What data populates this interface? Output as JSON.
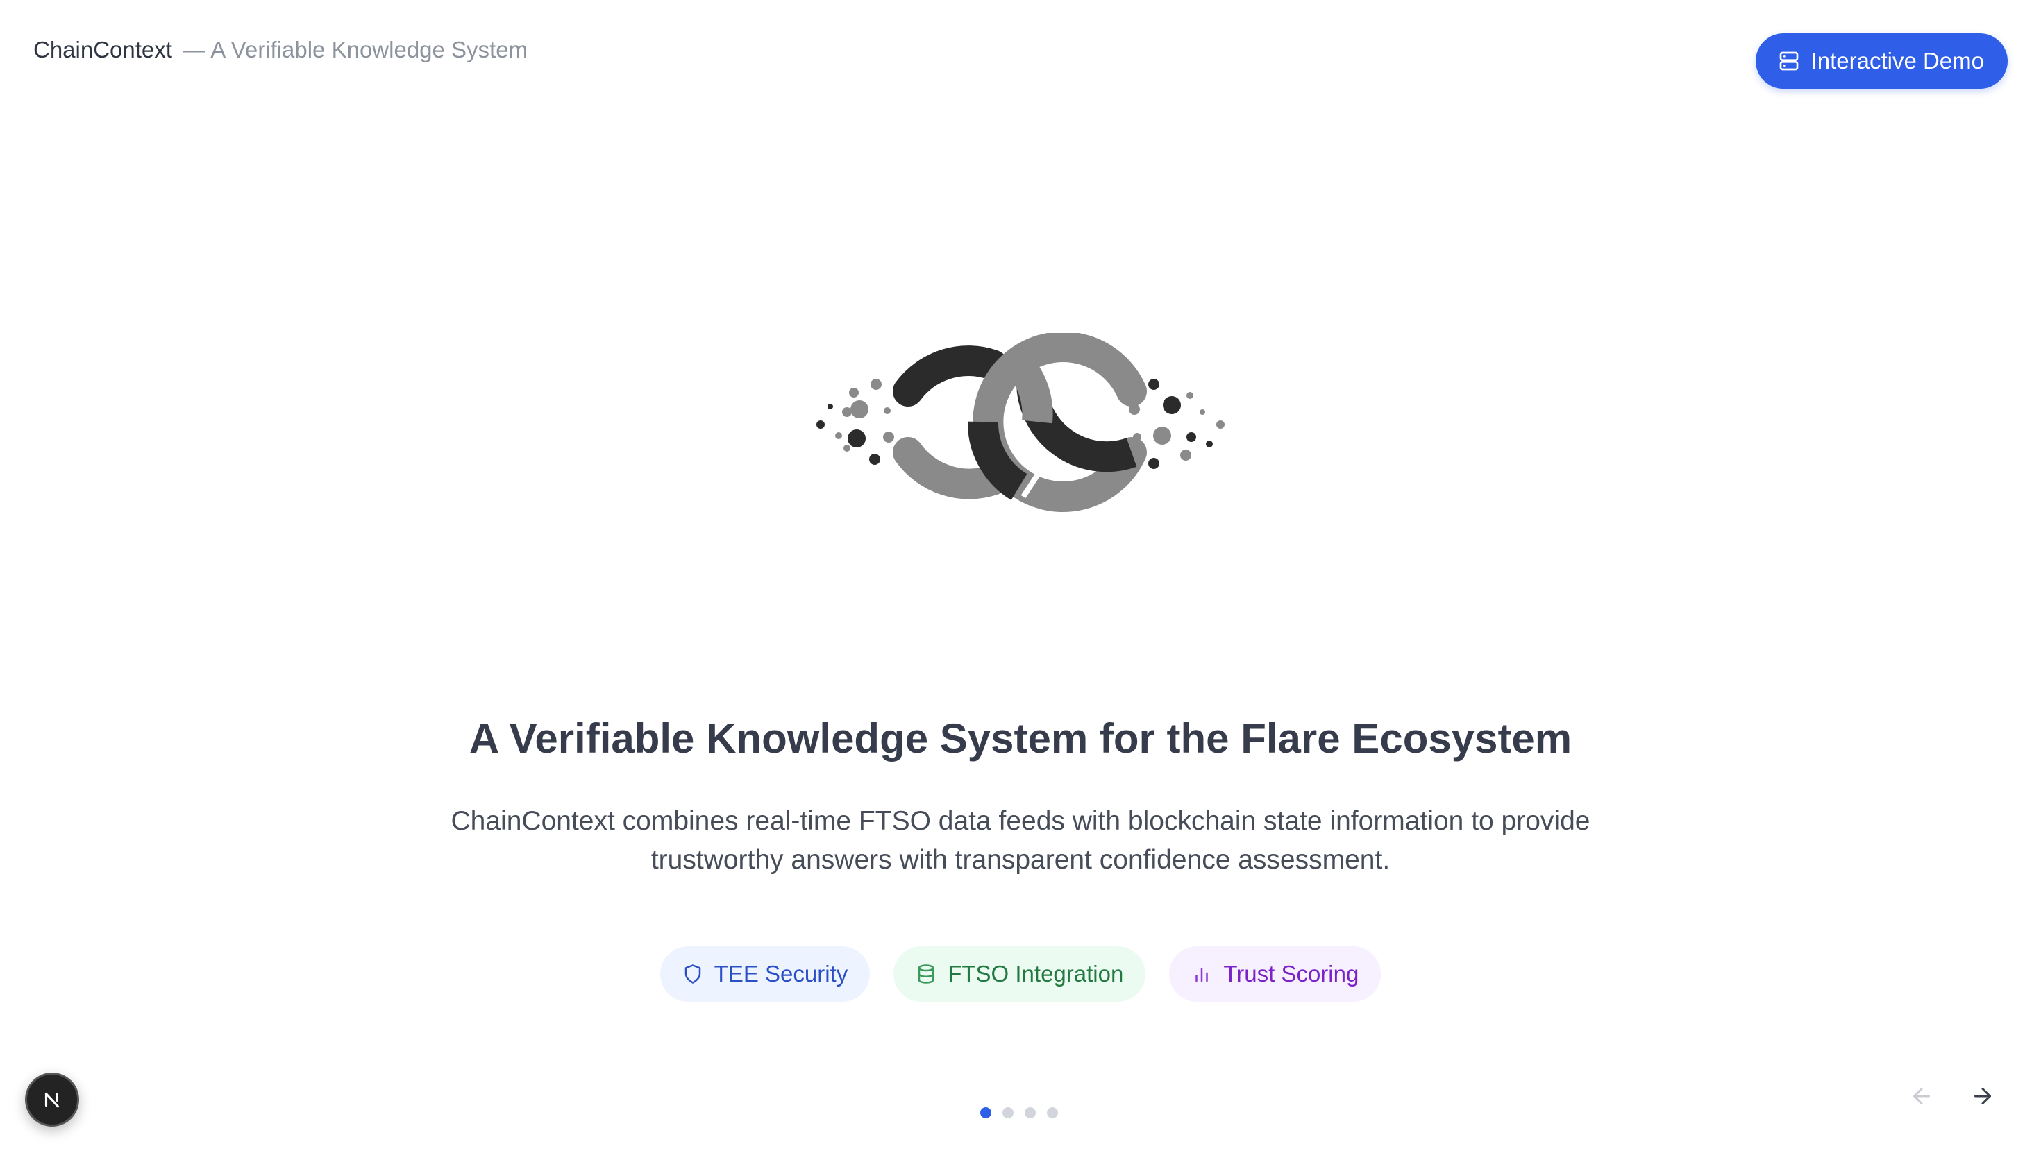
{
  "header": {
    "brand_name": "ChainContext",
    "brand_subtitle": "— A Verifiable Knowledge System",
    "demo_button": {
      "label": "Interactive Demo",
      "icon": "server-icon",
      "color": "#2f5ee8"
    }
  },
  "hero": {
    "logo_icon": "chaincontext-logo",
    "title": "A Verifiable Knowledge System for the Flare Ecosystem",
    "description": "ChainContext combines real-time FTSO data feeds with blockchain state information to provide trustworthy answers with transparent confidence assessment."
  },
  "features": [
    {
      "label": "TEE Security",
      "icon": "shield-icon",
      "color": "#2b4fc7",
      "background": "#eef4ff"
    },
    {
      "label": "FTSO Integration",
      "icon": "database-icon",
      "color": "#237a41",
      "background": "#ecfbf1"
    },
    {
      "label": "Trust Scoring",
      "icon": "bar-chart-icon",
      "color": "#7a23c8",
      "background": "#f7f0ff"
    }
  ],
  "pagination": {
    "total_slides": 4,
    "current_slide": 1,
    "prev_icon": "arrow-left-icon",
    "next_icon": "arrow-right-icon"
  },
  "framework_badge": {
    "icon": "nextjs-n-icon"
  }
}
